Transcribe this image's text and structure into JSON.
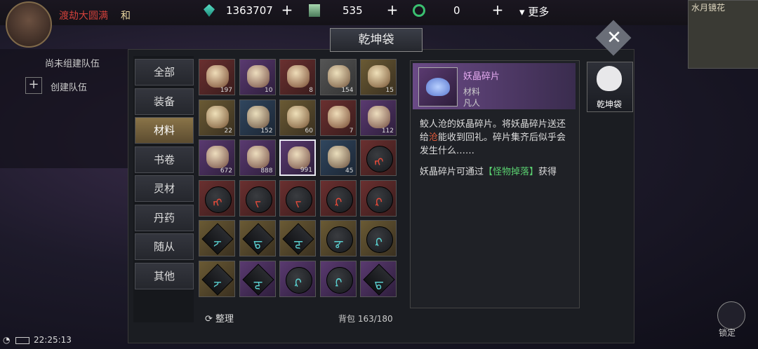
{
  "player": {
    "name": "渡劫大圆满",
    "state": "和"
  },
  "resources": [
    {
      "icon": "jade-gem-icon",
      "value": "1363707"
    },
    {
      "icon": "scroll-token-icon",
      "value": "535"
    },
    {
      "icon": "green-ring-icon",
      "value": "0"
    }
  ],
  "more_label": "更多",
  "minimap": {
    "title": "水月镜花"
  },
  "team": {
    "status": "尚未组建队伍",
    "create": "创建队伍"
  },
  "window": {
    "title": "乾坤袋"
  },
  "tabs": [
    "全部",
    "装备",
    "材料",
    "书卷",
    "灵材",
    "丹药",
    "随从",
    "其他"
  ],
  "active_tab": "材料",
  "items": [
    {
      "icon": "scroll-red-icon",
      "bg": "c-red",
      "count": "197"
    },
    {
      "icon": "compass-ornament-icon",
      "bg": "c-purple",
      "count": "10"
    },
    {
      "icon": "fire-orb-icon",
      "bg": "c-red",
      "count": "8"
    },
    {
      "icon": "paper-bundle-icon",
      "bg": "c-white",
      "count": "154"
    },
    {
      "icon": "scroll-gold-icon",
      "bg": "c-gold",
      "count": "15"
    },
    {
      "icon": "amber-egg-icon",
      "bg": "c-gold",
      "count": "22"
    },
    {
      "icon": "blue-silk-icon",
      "bg": "c-blue",
      "count": "152"
    },
    {
      "icon": "brown-ore-icon",
      "bg": "c-gold",
      "count": "60"
    },
    {
      "icon": "amber-stone-icon",
      "bg": "c-red",
      "count": "7"
    },
    {
      "icon": "parchment-icon",
      "bg": "c-purple",
      "count": "112"
    },
    {
      "icon": "amber-egg-icon",
      "bg": "c-purple",
      "count": "672"
    },
    {
      "icon": "crystal-cluster-icon",
      "bg": "c-purple",
      "count": "888"
    },
    {
      "icon": "demon-crystal-lotus-icon",
      "bg": "c-purple",
      "count": "991"
    },
    {
      "icon": "jade-scroll-icon",
      "bg": "c-blue",
      "count": "45"
    },
    {
      "icon": "rune-orb-icon",
      "bg": "c-red",
      "count": ""
    },
    {
      "icon": "rune-orb-icon",
      "bg": "c-red",
      "count": ""
    },
    {
      "icon": "rune-orb-icon",
      "bg": "c-red",
      "count": ""
    },
    {
      "icon": "rune-orb-icon",
      "bg": "c-red",
      "count": ""
    },
    {
      "icon": "rune-orb-icon",
      "bg": "c-red",
      "count": ""
    },
    {
      "icon": "rune-orb-icon",
      "bg": "c-red",
      "count": ""
    },
    {
      "icon": "rune-diamond-icon",
      "bg": "c-gold",
      "count": ""
    },
    {
      "icon": "rune-diamond-icon",
      "bg": "c-gold",
      "count": ""
    },
    {
      "icon": "rune-diamond-icon",
      "bg": "c-gold",
      "count": ""
    },
    {
      "icon": "rune-orb-icon",
      "bg": "c-gold",
      "count": ""
    },
    {
      "icon": "rune-orb-icon",
      "bg": "c-gold",
      "count": ""
    },
    {
      "icon": "rune-diamond-icon",
      "bg": "c-gold",
      "count": ""
    },
    {
      "icon": "rune-diamond-icon",
      "bg": "c-purple",
      "count": ""
    },
    {
      "icon": "rune-orb-icon",
      "bg": "c-purple",
      "count": ""
    },
    {
      "icon": "rune-orb-icon",
      "bg": "c-purple",
      "count": ""
    },
    {
      "icon": "rune-diamond-icon",
      "bg": "c-purple",
      "count": ""
    }
  ],
  "rune_glyphs": [
    "ᡊ",
    "ᡊ",
    "ᡕ",
    "ᡕ",
    "ᡘ",
    "ᡘ",
    "ᡔ",
    "ᡖ",
    "ᡓ",
    "ᡒ",
    "ᡘ",
    "ᡔ",
    "ᡓ",
    "ᡘ",
    "ᡗ",
    "ᡖ"
  ],
  "sort_label": "整理",
  "bag_label": "背包",
  "bag_count": "163/180",
  "detail": {
    "name": "妖晶碎片",
    "type": "材料",
    "rank": "凡人",
    "desc_pre": "鲛人沧的妖晶碎片。将妖晶碎片送还给",
    "desc_hl": "沧",
    "desc_post": "能收到回礼。碎片集齐后似乎会发生什么……",
    "src_pre": "妖晶碎片可通过",
    "src_hl": "【怪物掉落】",
    "src_post": "获得"
  },
  "side_tab": "乾坤袋",
  "clock": "22:25:13",
  "lock_label": "锁定"
}
